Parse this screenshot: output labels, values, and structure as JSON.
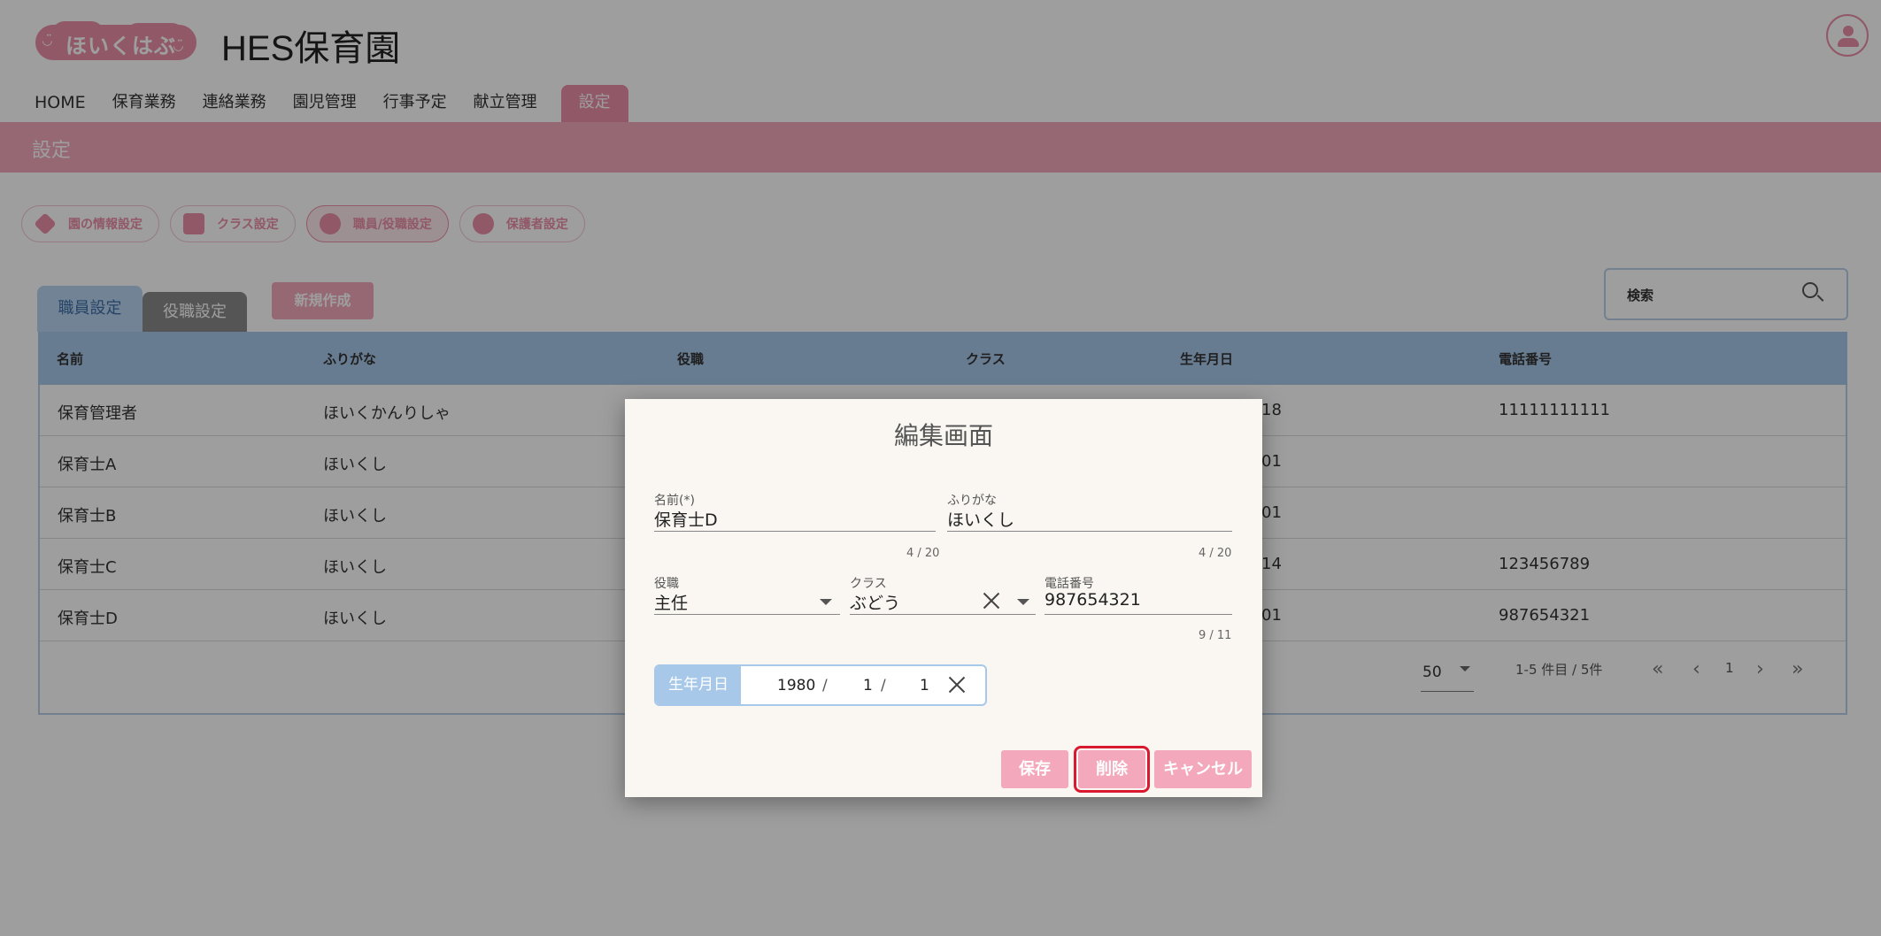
{
  "header": {
    "logo_text": "ほいくはぶ",
    "logo_face_left": "◡̈",
    "logo_face_right": "◡̈",
    "site_title": "HES保育園"
  },
  "nav": {
    "items": [
      "HOME",
      "保育業務",
      "連絡業務",
      "園児管理",
      "行事予定",
      "献立管理",
      "設定"
    ]
  },
  "banner": {
    "title": "設定"
  },
  "chips": [
    "園の情報設定",
    "クラス設定",
    "職員/役職設定",
    "保護者設定"
  ],
  "tabs": {
    "staff": "職員設定",
    "role": "役職設定"
  },
  "new_button": "新規作成",
  "search": {
    "placeholder": "検索"
  },
  "table": {
    "headers": [
      "名前",
      "ふりがな",
      "役職",
      "クラス",
      "生年月日",
      "電話番号"
    ],
    "rows": [
      {
        "name": "保育管理者",
        "kana": "ほいくかんりしゃ",
        "birth": "18",
        "phone": "11111111111"
      },
      {
        "name": "保育士A",
        "kana": "ほいくし",
        "birth": "01",
        "phone": ""
      },
      {
        "name": "保育士B",
        "kana": "ほいくし",
        "birth": "01",
        "phone": ""
      },
      {
        "name": "保育士C",
        "kana": "ほいくし",
        "birth": "14",
        "phone": "123456789"
      },
      {
        "name": "保育士D",
        "kana": "ほいくし",
        "birth": "01",
        "phone": "987654321"
      }
    ]
  },
  "pager": {
    "per_page": "50",
    "range": "1-5 件目 / 5件",
    "page": "1"
  },
  "modal": {
    "title": "編集画面",
    "name_label": "名前(*)",
    "name_value": "保育士D",
    "name_counter": "4 / 20",
    "kana_label": "ふりがな",
    "kana_value": "ほいくし",
    "kana_counter": "4 / 20",
    "role_label": "役職",
    "role_value": "主任",
    "class_label": "クラス",
    "class_value": "ぶどう",
    "phone_label": "電話番号",
    "phone_value": "987654321",
    "phone_counter": "9 / 11",
    "birth_label": "生年月日",
    "birth_year": "1980",
    "birth_month": "1",
    "birth_day": "1",
    "date_sep": "/",
    "save": "保存",
    "delete": "削除",
    "cancel": "キャンセル"
  },
  "colors": {
    "accent": "#ea8ea6",
    "table_header": "#a8c8ea",
    "highlight": "#d8192f"
  }
}
